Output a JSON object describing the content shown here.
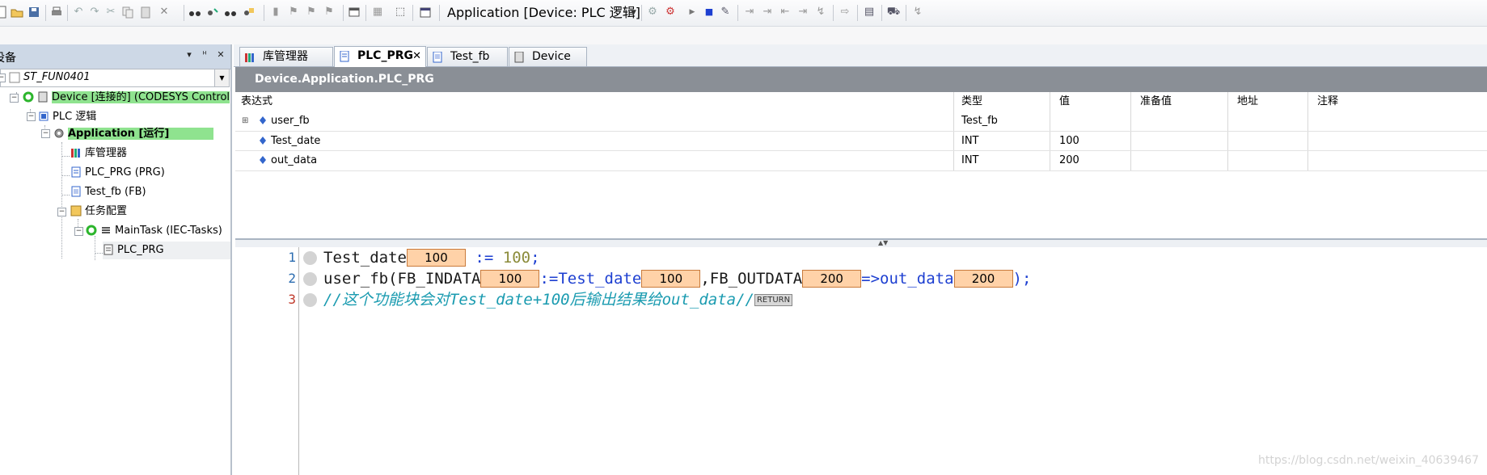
{
  "toolbar": {
    "application_selector": "Application [Device: PLC 逻辑]"
  },
  "left_panel": {
    "title": "设备",
    "project": "ST_FUN0401",
    "tree": [
      {
        "label": "Device [连接的] (CODESYS Control",
        "highlight": true
      },
      {
        "label": "PLC 逻辑"
      },
      {
        "label": "Application [运行]",
        "highlight": true,
        "bold": true
      },
      {
        "label": "库管理器"
      },
      {
        "label": "PLC_PRG (PRG)"
      },
      {
        "label": "Test_fb (FB)"
      },
      {
        "label": "任务配置"
      },
      {
        "label": "MainTask (IEC-Tasks)"
      },
      {
        "label": "PLC_PRG"
      }
    ]
  },
  "tabs": [
    {
      "label": "库管理器"
    },
    {
      "label": "PLC_PRG",
      "active": true
    },
    {
      "label": "Test_fb"
    },
    {
      "label": "Device"
    }
  ],
  "editor": {
    "path": "Device.Application.PLC_PRG",
    "watch": {
      "columns": [
        "表达式",
        "类型",
        "值",
        "准备值",
        "地址",
        "注释"
      ],
      "rows": [
        {
          "expr": "user_fb",
          "type": "Test_fb",
          "value": "",
          "expandable": true
        },
        {
          "expr": "Test_date",
          "type": "INT",
          "value": "100"
        },
        {
          "expr": "out_data",
          "type": "INT",
          "value": "200"
        }
      ]
    },
    "code": {
      "line_numbers": [
        "1",
        "2",
        "3"
      ],
      "line1": {
        "ident": "Test_date",
        "mon": "100",
        "op": ":=",
        "num": "100",
        "semi": ";"
      },
      "line2": {
        "ident": "user_fb(FB_INDATA",
        "mon1": "100",
        "op1": ":=Test_date",
        "mon2": "100",
        "op2": ",FB_OUTDATA",
        "mon3": "200",
        "op3": "=>out_data",
        "mon4": "200",
        "end": ");"
      },
      "line3": {
        "comment": "//这个功能块会对Test_date+100后输出结果给out_data//",
        "return_marker": "RETURN"
      }
    }
  },
  "watermark": "https://blog.csdn.net/weixin_40639467"
}
